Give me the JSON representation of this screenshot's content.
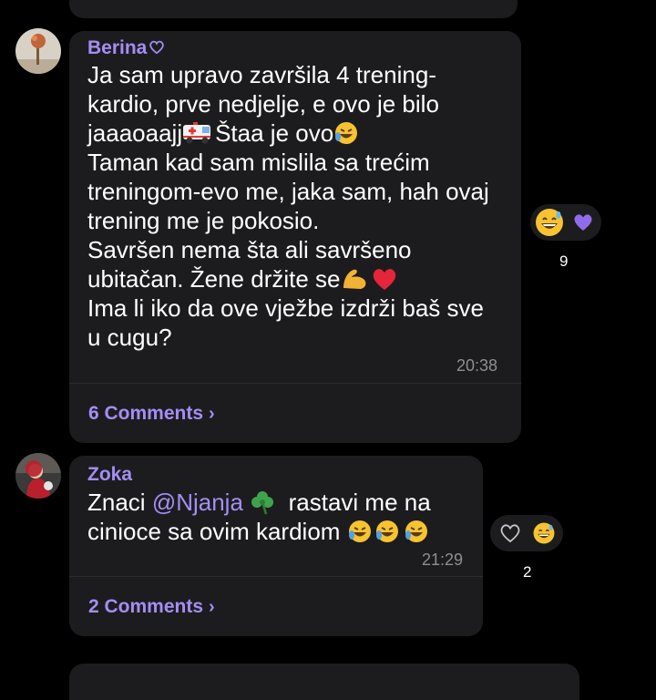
{
  "posts": [
    {
      "sender": "Berina",
      "lines": [
        "Ja sam upravo završila 4 trening-",
        "kardio, prve nedjelje, e ovo je bilo",
        "jaaaoaajj",
        "Štaa je ovo",
        "Taman kad sam mislila sa trećim",
        "treningom-evo me, jaka sam, hah ovaj",
        "trening me je pokosio.",
        "Savršen nema šta ali savršeno",
        "ubitačan. Žene držite se",
        "Ima li iko da ove vježbe izdrži baš sve",
        "u cugu?"
      ],
      "time": "20:38",
      "comments": "6 Comments",
      "reaction_count": "9",
      "icons": [
        "ambulance-emoji",
        "rofl-emoji",
        "flexed-biceps-emoji",
        "red-heart-emoji",
        "grinning-sweat-emoji",
        "purple-heart-emoji"
      ]
    },
    {
      "sender": "Zoka",
      "line1_prefix": "Znaci ",
      "mention": "@Njanja",
      "line1_suffix": "rastavi me na",
      "line2": "cinioce sa ovim kardiom",
      "time": "21:29",
      "comments": "2 Comments",
      "reaction_count": "2",
      "icons": [
        "clover-emoji",
        "rofl-emoji",
        "outline-heart-icon",
        "grinning-sweat-emoji"
      ]
    }
  ],
  "colors": {
    "background": "#000000",
    "bubble": "#1c1c1e",
    "accent": "#a48ef5",
    "timestamp": "#8e8e93"
  }
}
